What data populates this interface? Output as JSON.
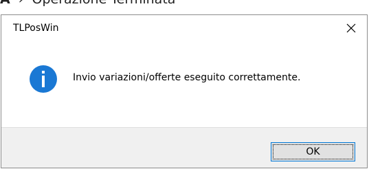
{
  "page": {
    "heading_mark": "A",
    "heading_text": "Operazione Terminata"
  },
  "dialog": {
    "title": "TLPosWin",
    "message": "Invio variazioni/offerte eseguito correttamente.",
    "ok_label": "OK",
    "icon": "info-icon",
    "close_icon": "close-icon"
  },
  "colors": {
    "info_icon": "#1a78d4",
    "footer_bg": "#f0f0f0",
    "ok_border": "#0078d7"
  }
}
